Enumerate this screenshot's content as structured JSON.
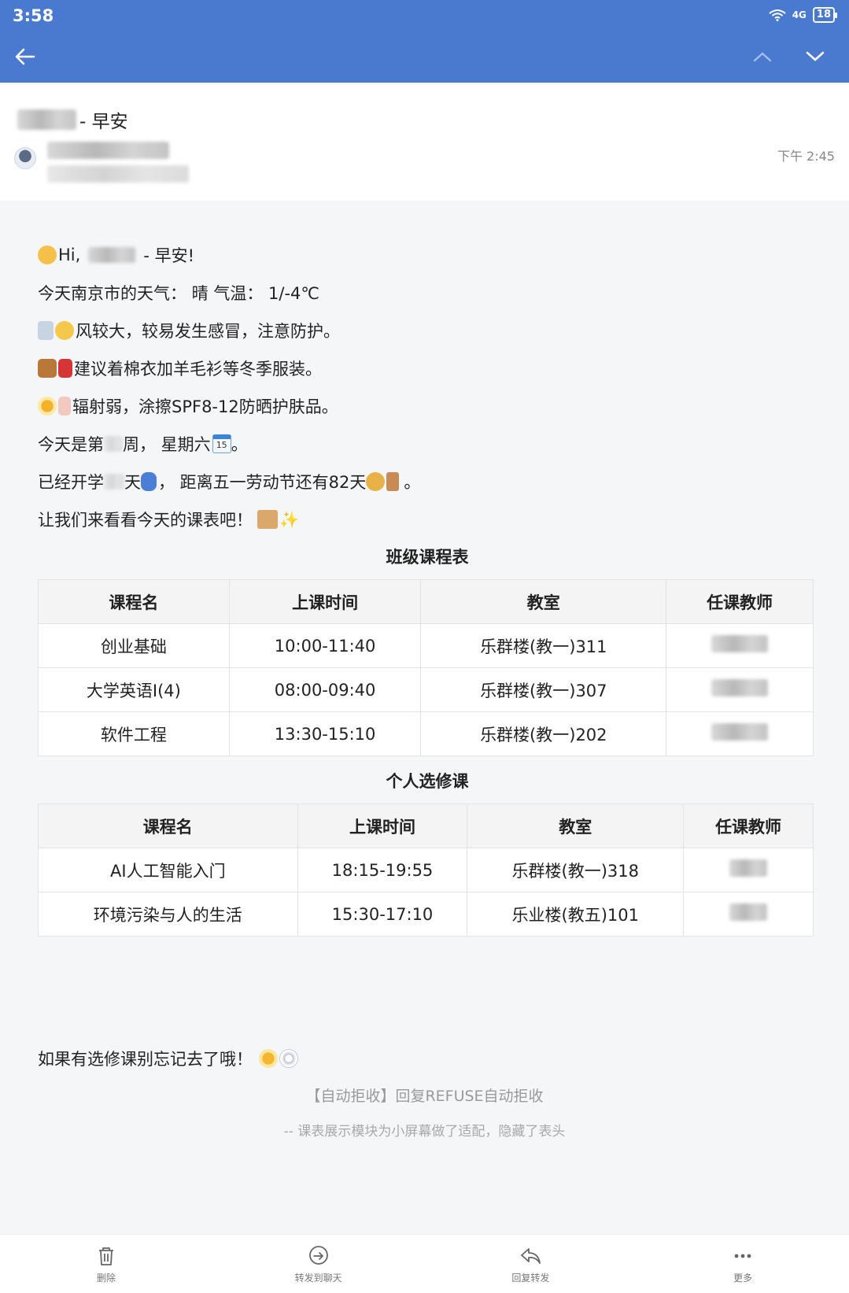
{
  "status_bar": {
    "time": "3:58",
    "signal_label": "4G",
    "battery": "18"
  },
  "header": {
    "subject_suffix": "- 早安",
    "time": "下午 2:45"
  },
  "body": {
    "greeting_hi": "Hi,",
    "greeting_suffix": "- 早安!",
    "weather": "今天南京市的天气：   晴  气温：  1/-4℃",
    "wind": "风较大，较易发生感冒，注意防护。",
    "clothing": "建议着棉衣加羊毛衫等冬季服装。",
    "uv": "辐射弱，涂擦SPF8-12防晒护肤品。",
    "week_prefix": "今天是第",
    "week_suffix": "周，  星期六",
    "calendar_day": "15",
    "week_end": "。",
    "school_prefix": "已经开学",
    "school_mid": "天",
    "school_suffix": "，  距离五一劳动节还有82天",
    "school_end": "。",
    "lets_see": "让我们来看看今天的课表吧！"
  },
  "class_table": {
    "title": "班级课程表",
    "headers": [
      "课程名",
      "上课时间",
      "教室",
      "任课教师"
    ],
    "rows": [
      [
        "创业基础",
        "10:00-11:40",
        "乐群楼(教一)311"
      ],
      [
        "大学英语I(4)",
        "08:00-09:40",
        "乐群楼(教一)307"
      ],
      [
        "软件工程",
        "13:30-15:10",
        "乐群楼(教一)202"
      ]
    ]
  },
  "elective_table": {
    "title": "个人选修课",
    "headers": [
      "课程名",
      "上课时间",
      "教室",
      "任课教师"
    ],
    "rows": [
      [
        "AI人工智能入门",
        "18:15-19:55",
        "乐群楼(教一)318"
      ],
      [
        "环境污染与人的生活",
        "15:30-17:10",
        "乐业楼(教五)101"
      ]
    ]
  },
  "footer": {
    "reminder": "如果有选修课别忘记去了哦！",
    "auto_reject": "【自动拒收】回复REFUSE自动拒收",
    "note": "-- 课表展示模块为小屏幕做了适配，隐藏了表头"
  },
  "bottom_bar": {
    "delete": "删除",
    "forward_chat": "转发到聊天",
    "reply_forward": "回复转发",
    "more": "更多"
  },
  "colors": {
    "topbar": "#4a7ad0"
  }
}
